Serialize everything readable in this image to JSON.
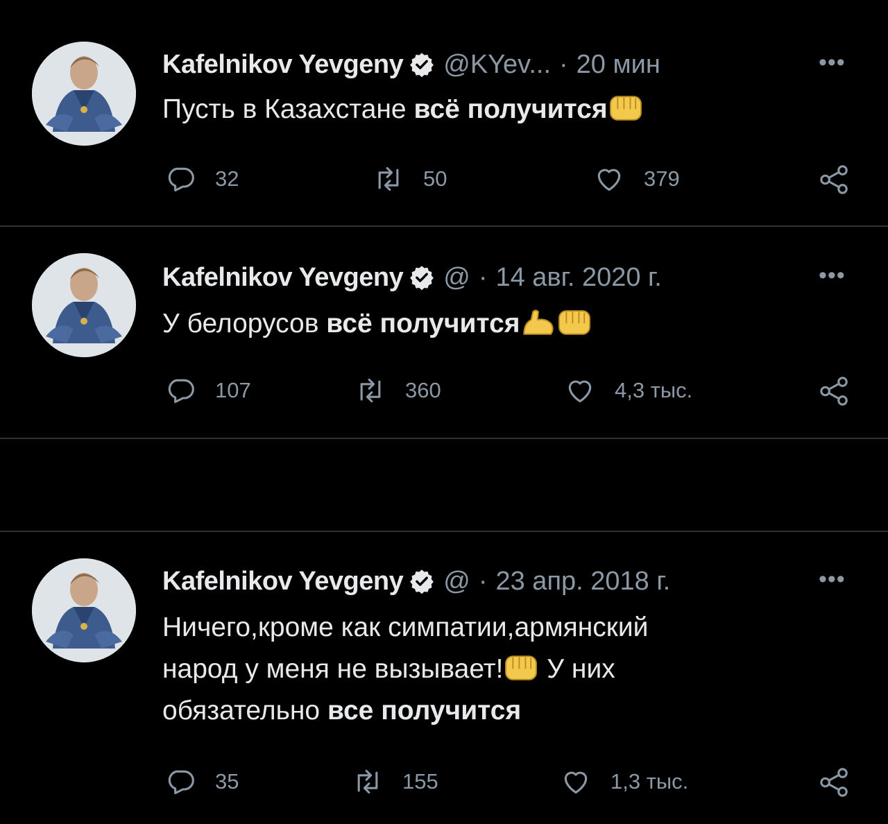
{
  "tweets": [
    {
      "name": "Kafelnikov Yevgeny",
      "handle": "@KYev...",
      "dot": "·",
      "time": "20 мин",
      "text_regular": "Пусть в Казахстане ",
      "text_bold": "всё получится",
      "replies": "32",
      "retweets": "50",
      "likes": "379"
    },
    {
      "name": "Kafelnikov Yevgeny",
      "handle": "@",
      "dot": "·",
      "time": "14 авг. 2020 г.",
      "text_regular": "У белорусов ",
      "text_bold": "всё получится",
      "replies": "107",
      "retweets": "360",
      "likes": "4,3 тыс."
    },
    {
      "name": "Kafelnikov Yevgeny",
      "handle": "@",
      "dot": "·",
      "time": "23 апр. 2018 г.",
      "line1": "Ничего,кроме как симпатии,армянский",
      "line2a": "народ у меня не вызывает!",
      "line2b": " У них",
      "line3a": "обязательно ",
      "line3b": "все получится",
      "replies": "35",
      "retweets": "155",
      "likes": "1,3 тыс."
    }
  ],
  "more_label": "•••",
  "icons": {
    "verified": "verified-badge-icon",
    "reply": "reply-icon",
    "retweet": "retweet-icon",
    "like": "heart-icon",
    "share": "share-icon",
    "fist": "oncoming-fist-emoji",
    "bicep": "flexed-biceps-emoji"
  },
  "colors": {
    "background": "#000000",
    "text": "#e7e9ea",
    "muted": "#8b98a5",
    "divider": "#2f3336",
    "emoji": "#f2c94c"
  }
}
